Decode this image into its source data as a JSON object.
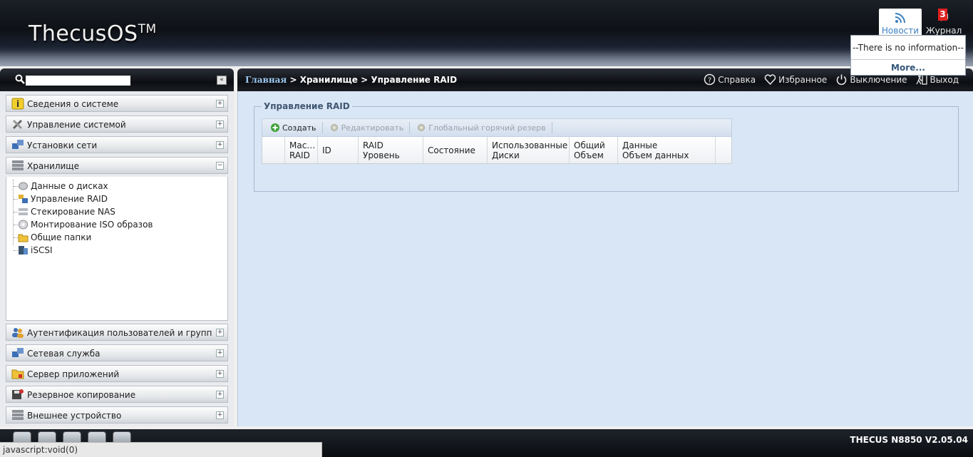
{
  "header": {
    "logo": "ThecusOS",
    "logo_tm": "TM",
    "news_label": "Новости",
    "journal_label": "Журнал",
    "journal_count": "3",
    "news_popup": {
      "empty_text": "--There is no information--",
      "more_label": "More..."
    }
  },
  "search": {
    "value": "",
    "collapse_label": "«"
  },
  "breadcrumb": {
    "home": "Главная",
    "path": " > Хранилище > Управление RAID"
  },
  "toolbar": {
    "help": "Справка",
    "favorites": "Избранное",
    "shutdown": "Выключение",
    "logout": "Выход"
  },
  "sidebar": {
    "panels": [
      {
        "label": "Сведения о системе",
        "icon": "info-icon",
        "toggle": "+"
      },
      {
        "label": "Управление системой",
        "icon": "tools-icon",
        "toggle": "+"
      },
      {
        "label": "Установки сети",
        "icon": "network-icon",
        "toggle": "+"
      },
      {
        "label": "Хранилище",
        "icon": "storage-icon",
        "toggle": "−"
      },
      {
        "label": "Аутентификация пользователей и групп",
        "icon": "users-icon",
        "toggle": "+"
      },
      {
        "label": "Сетевая служба",
        "icon": "network-service-icon",
        "toggle": "+"
      },
      {
        "label": "Сервер приложений",
        "icon": "app-server-icon",
        "toggle": "+"
      },
      {
        "label": "Резервное копирование",
        "icon": "backup-icon",
        "toggle": "+"
      },
      {
        "label": "Внешнее устройство",
        "icon": "external-device-icon",
        "toggle": "+"
      }
    ],
    "storage_items": [
      {
        "label": "Данные о дисках",
        "icon": "disk-icon"
      },
      {
        "label": "Управление RAID",
        "icon": "raid-icon"
      },
      {
        "label": "Стекирование NAS",
        "icon": "nas-stack-icon"
      },
      {
        "label": "Монтирование ISO образов",
        "icon": "iso-icon"
      },
      {
        "label": "Общие папки",
        "icon": "folder-icon"
      },
      {
        "label": "iSCSI",
        "icon": "iscsi-icon"
      }
    ]
  },
  "main": {
    "section_title": "Управление RAID",
    "buttons": {
      "create": "Создать",
      "edit": "Редактировать",
      "global_spare": "Глобальный горячий резерв"
    },
    "columns": [
      {
        "line1": "",
        "line2": ""
      },
      {
        "line1": "Мас…",
        "line2": "RAID"
      },
      {
        "line1": "ID",
        "line2": ""
      },
      {
        "line1": "RAID",
        "line2": "Уровень"
      },
      {
        "line1": "Состояние",
        "line2": ""
      },
      {
        "line1": "Использованные",
        "line2": "Диски"
      },
      {
        "line1": "Общий",
        "line2": "Объем"
      },
      {
        "line1": "Данные",
        "line2": "Объем данных"
      },
      {
        "line1": "",
        "line2": ""
      }
    ]
  },
  "footer": {
    "version": "THECUS N8850 V2.05.04",
    "status_text": "javascript:void(0)"
  },
  "colors": {
    "accent": "#3a7fc0",
    "content_bg": "#d9e6f6",
    "badge": "#e02020"
  }
}
